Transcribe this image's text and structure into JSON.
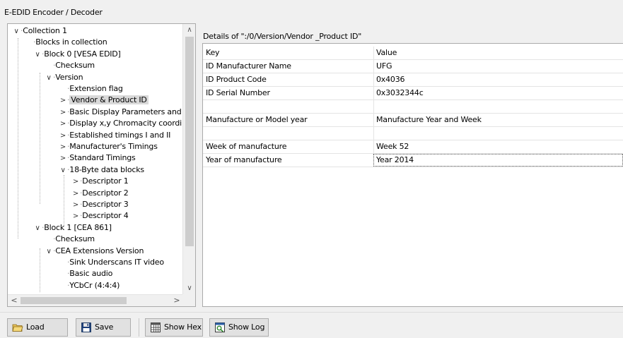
{
  "window": {
    "title": "E-EDID Encoder / Decoder"
  },
  "tree": {
    "items": [
      {
        "label": "Collection 1",
        "chev": "∨"
      },
      {
        "label": "Blocks in collection",
        "chev": ""
      },
      {
        "label": "Block 0 [VESA EDID]",
        "chev": "∨"
      },
      {
        "label": "Checksum",
        "chev": ""
      },
      {
        "label": "Version",
        "chev": "∨"
      },
      {
        "label": "Extension flag",
        "chev": ""
      },
      {
        "label": "Vendor & Product ID",
        "chev": ">"
      },
      {
        "label": "Basic Display Parameters and F",
        "chev": ">"
      },
      {
        "label": "Display x,y Chromacity coordin",
        "chev": ">"
      },
      {
        "label": "Established timings I and II",
        "chev": ">"
      },
      {
        "label": "Manufacturer's Timings",
        "chev": ">"
      },
      {
        "label": "Standard Timings",
        "chev": ">"
      },
      {
        "label": "18-Byte data blocks",
        "chev": "∨"
      },
      {
        "label": "Descriptor 1",
        "chev": ">"
      },
      {
        "label": "Descriptor 2",
        "chev": ">"
      },
      {
        "label": "Descriptor 3",
        "chev": ">"
      },
      {
        "label": "Descriptor 4",
        "chev": ">"
      },
      {
        "label": "Block 1 [CEA 861]",
        "chev": "∨"
      },
      {
        "label": "Checksum",
        "chev": ""
      },
      {
        "label": "CEA Extensions Version",
        "chev": "∨"
      },
      {
        "label": "Sink Underscans IT video",
        "chev": ""
      },
      {
        "label": "Basic audio",
        "chev": ""
      },
      {
        "label": "YCbCr (4:4:4)",
        "chev": ""
      }
    ],
    "scroll_up": "∧",
    "scroll_down": "∨",
    "scroll_left": "<",
    "scroll_right": ">"
  },
  "details": {
    "title": "Details of \":/0/Version/Vendor _Product ID\"",
    "columns": {
      "key": "Key",
      "value": "Value"
    },
    "rows": [
      {
        "key": "ID Manufacturer Name",
        "value": "UFG"
      },
      {
        "key": "ID Product Code",
        "value": "0x4036"
      },
      {
        "key": "ID Serial Number",
        "value": "0x3032344c"
      },
      {
        "key": "",
        "value": ""
      },
      {
        "key": "Manufacture or Model year",
        "value": "Manufacture Year and Week"
      },
      {
        "key": "",
        "value": ""
      },
      {
        "key": "Week of manufacture",
        "value": "Week 52"
      },
      {
        "key": "Year of manufacture",
        "value": "Year 2014"
      }
    ]
  },
  "toolbar": {
    "load": "Load",
    "save": "Save",
    "show_hex": "Show Hex",
    "show_log": "Show Log"
  },
  "icons": {
    "load": "folder-open-icon",
    "save": "floppy-disk-icon",
    "show_hex": "hex-grid-icon",
    "show_log": "log-viewer-icon"
  }
}
